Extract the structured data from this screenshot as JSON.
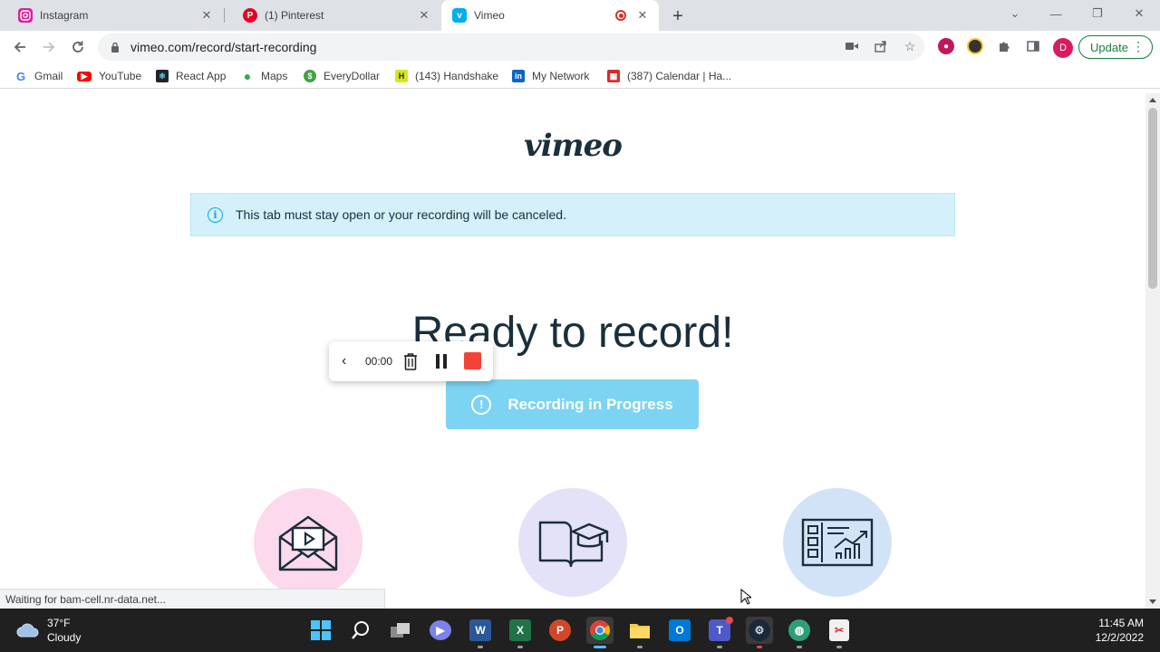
{
  "browser": {
    "tabs": [
      {
        "label": "Instagram",
        "icon": "instagram-icon",
        "active": false
      },
      {
        "label": "(1) Pinterest",
        "icon": "pinterest-icon",
        "active": false
      },
      {
        "label": "Vimeo",
        "icon": "vimeo-icon",
        "active": true,
        "recording": true
      }
    ],
    "address": "vimeo.com/record/start-recording",
    "update_label": "Update",
    "profile_initial": "D"
  },
  "bookmarks": [
    {
      "label": "Gmail",
      "icon": "google-icon"
    },
    {
      "label": "YouTube",
      "icon": "youtube-icon"
    },
    {
      "label": "React App",
      "icon": "react-icon"
    },
    {
      "label": "Maps",
      "icon": "maps-icon"
    },
    {
      "label": "EveryDollar",
      "icon": "everydollar-icon"
    },
    {
      "label": "(143) Handshake",
      "icon": "handshake-icon"
    },
    {
      "label": "My Network",
      "icon": "linkedin-icon"
    },
    {
      "label": "(387) Calendar | Ha...",
      "icon": "calendar-icon"
    }
  ],
  "page": {
    "logo": "vimeo",
    "notice": "This tab must stay open or your recording will be canceled.",
    "headline": "Ready to record!",
    "recorder": {
      "time": "00:00"
    },
    "progress_button": "Recording in Progress",
    "features": [
      {
        "icon": "video-mail-icon",
        "bg": "#fcd9ec"
      },
      {
        "icon": "education-book-icon",
        "bg": "#e4e2f8"
      },
      {
        "icon": "presentation-chart-icon",
        "bg": "#d3e3f7"
      }
    ]
  },
  "status_bar": "Waiting for bam-cell.nr-data.net...",
  "taskbar": {
    "weather": {
      "temp": "37°F",
      "condition": "Cloudy"
    },
    "clock": {
      "time": "11:45 AM",
      "date": "12/2/2022"
    }
  },
  "colors": {
    "vimeo_blue": "#00adef",
    "stop_red": "#f44336",
    "progress_bg": "#7dd3f2",
    "notice_bg": "#d4f0fa"
  }
}
